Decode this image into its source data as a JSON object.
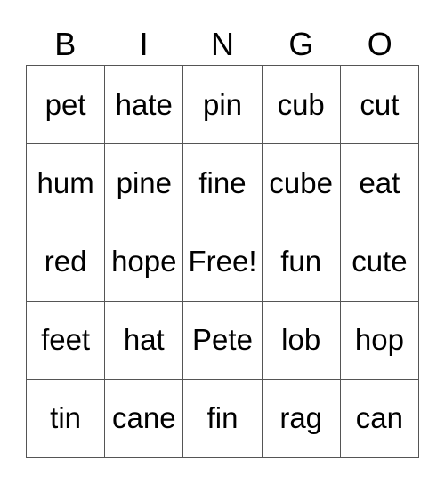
{
  "header": [
    "B",
    "I",
    "N",
    "G",
    "O"
  ],
  "cells": [
    [
      "pet",
      "hate",
      "pin",
      "cub",
      "cut"
    ],
    [
      "hum",
      "pine",
      "fine",
      "cube",
      "eat"
    ],
    [
      "red",
      "hope",
      "Free!",
      "fun",
      "cute"
    ],
    [
      "feet",
      "hat",
      "Pete",
      "lob",
      "hop"
    ],
    [
      "tin",
      "cane",
      "fin",
      "rag",
      "can"
    ]
  ]
}
